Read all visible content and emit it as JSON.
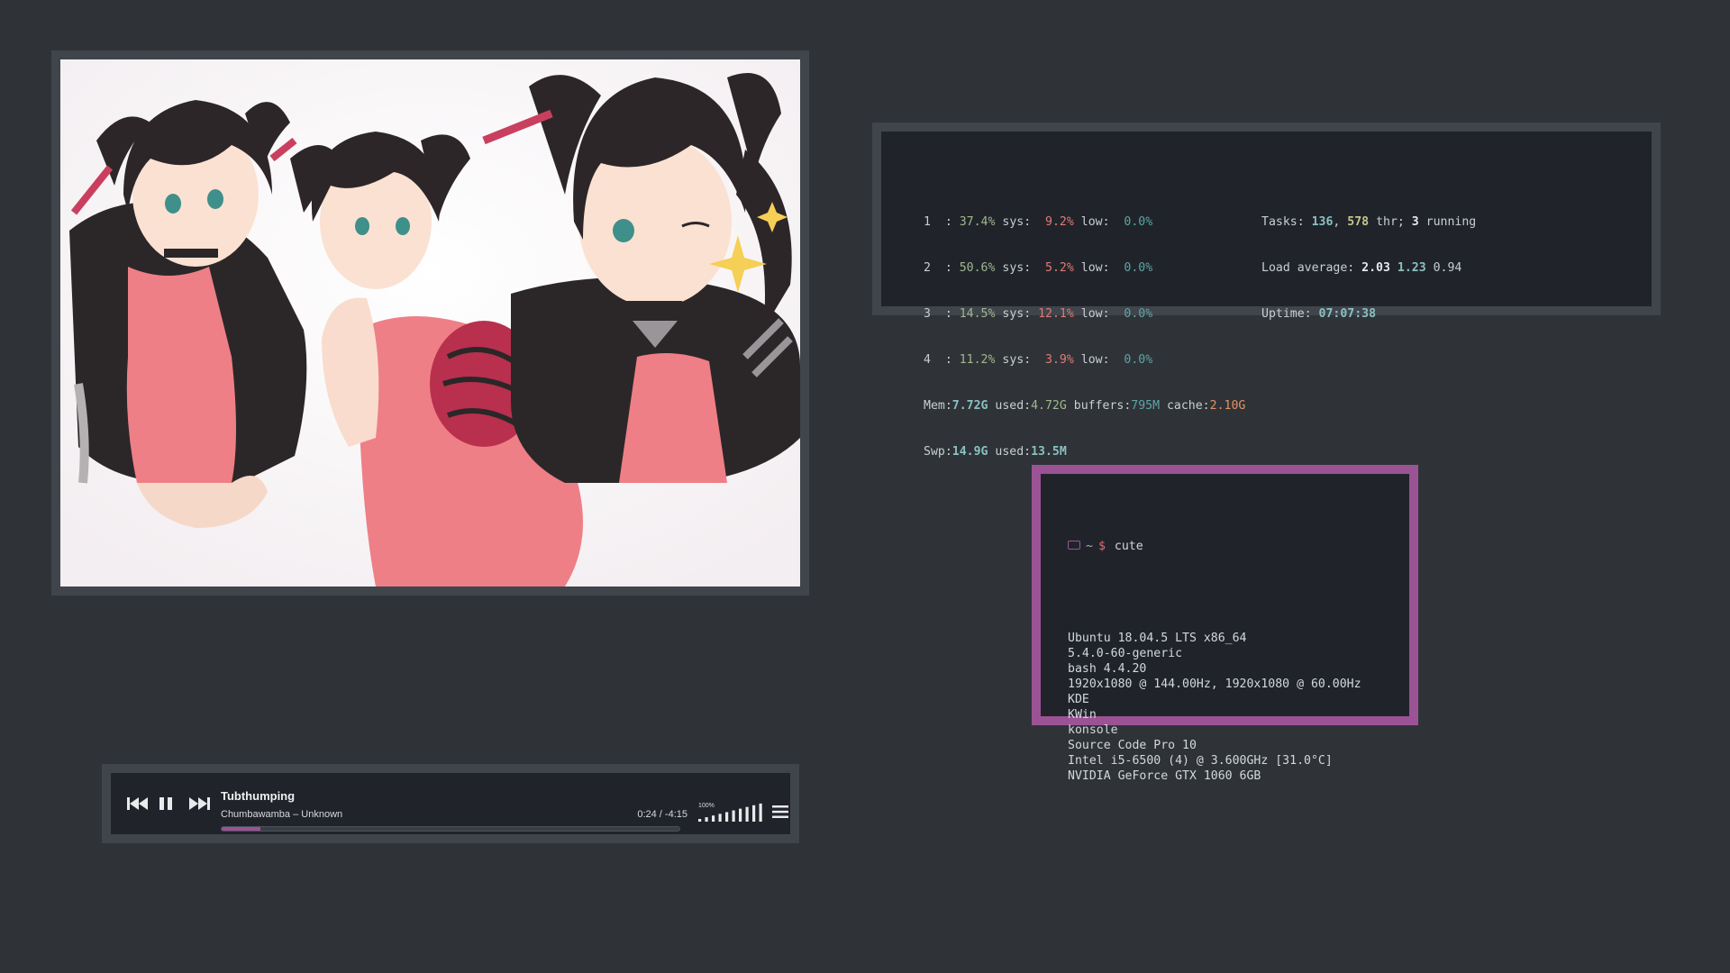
{
  "image_window": {
    "icon": "anime-artwork-image"
  },
  "htop": {
    "cpus": [
      {
        "id": "1",
        "usr": "37.4%",
        "sys": "9.2%",
        "low": "0.0%"
      },
      {
        "id": "2",
        "usr": "50.6%",
        "sys": "5.2%",
        "low": "0.0%"
      },
      {
        "id": "3",
        "usr": "14.5%",
        "sys": "12.1%",
        "low": "0.0%"
      },
      {
        "id": "4",
        "usr": "11.2%",
        "sys": "3.9%",
        "low": "0.0%"
      }
    ],
    "labels": {
      "sys": "sys:",
      "low": "low:"
    },
    "mem": {
      "label": "Mem:",
      "total": "7.72G",
      "used_label": " used:",
      "used": "4.72G",
      "buffers_label": " buffers:",
      "buffers": "795M",
      "cache_label": " cache:",
      "cache": "2.10G"
    },
    "swp": {
      "label": "Swp:",
      "total": "14.9G",
      "used_label": " used:",
      "used": "13.5M"
    },
    "tasks": {
      "label": "Tasks: ",
      "count": "136",
      "sep": ", ",
      "thr": "578",
      "thr_label": " thr; ",
      "running": "3",
      "running_label": " running"
    },
    "load": {
      "label": "Load average: ",
      "l1": "2.03",
      "l5": "1.23",
      "l15": "0.94"
    },
    "uptime": {
      "label": "Uptime: ",
      "value": "07:07:38"
    }
  },
  "neofetch": {
    "prompt_tilde": "~",
    "prompt_dollar": "$",
    "command": "cute",
    "lines": [
      "Ubuntu 18.04.5 LTS x86_64",
      "5.4.0-60-generic",
      "bash 4.4.20",
      "1920x1080 @ 144.00Hz, 1920x1080 @ 60.00Hz",
      "KDE",
      "KWin",
      "konsole",
      "Source Code Pro 10",
      "Intel i5-6500 (4) @ 3.600GHz [31.0°C]",
      "NVIDIA GeForce GTX 1060 6GB"
    ],
    "accent": "#9b5395"
  },
  "player": {
    "title": "Tubthumping",
    "artist": "Chumbawamba – Unknown",
    "time": "0:24 / -4:15",
    "progress_fraction": 0.085,
    "volume_label": "100%",
    "volume_fraction": 1.0,
    "accent": "#9b5395",
    "icons": {
      "prev": "skip-back-icon",
      "pause": "pause-icon",
      "next": "skip-forward-icon",
      "menu": "hamburger-menu-icon"
    }
  }
}
